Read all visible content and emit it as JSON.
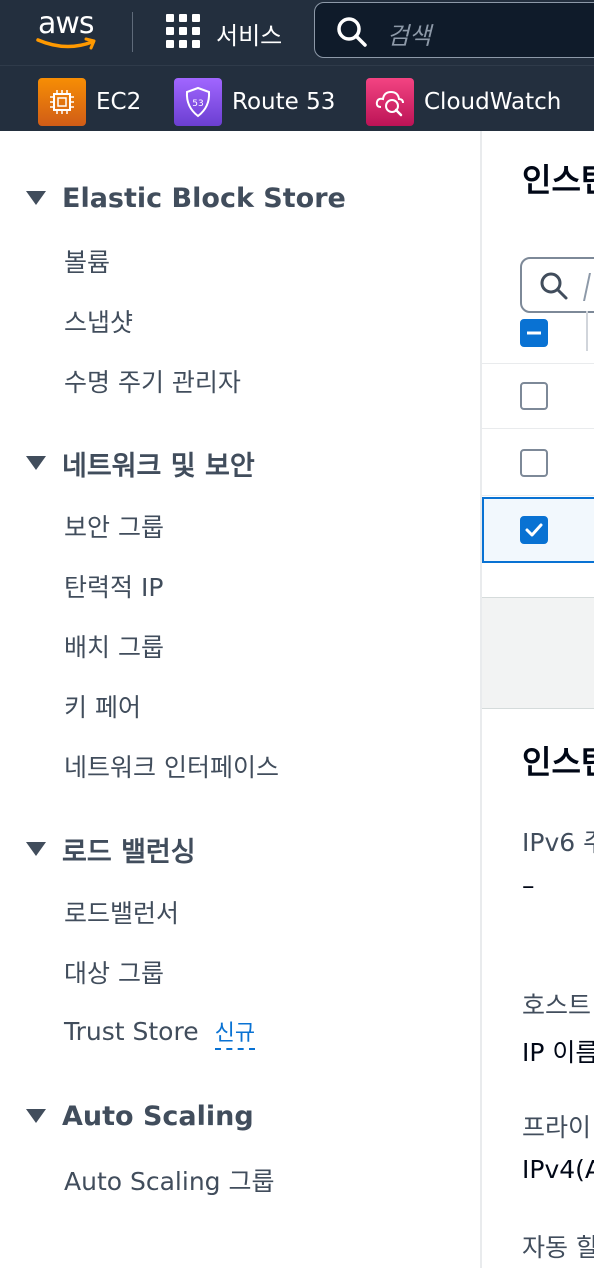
{
  "topbar": {
    "logo_text": "aws",
    "services_label": "서비스",
    "search_placeholder": "검색"
  },
  "favorites": [
    {
      "label": "EC2",
      "icon": "ec2-icon",
      "color": "#ed7100"
    },
    {
      "label": "Route 53",
      "icon": "route53-icon",
      "color": "#8c4fff"
    },
    {
      "label": "CloudWatch",
      "icon": "cloudwatch-icon",
      "color": "#e7157b"
    }
  ],
  "sidebar": {
    "sections": [
      {
        "title": "Elastic Block Store",
        "items": [
          "볼륨",
          "스냅샷",
          "수명 주기 관리자"
        ]
      },
      {
        "title": "네트워크 및 보안",
        "items": [
          "보안 그룹",
          "탄력적 IP",
          "배치 그룹",
          "키 페어",
          "네트워크 인터페이스"
        ]
      },
      {
        "title": "로드 밸런싱",
        "items": [
          "로드밸런서",
          "대상 그룹",
          "Trust Store"
        ],
        "badge": "신규"
      },
      {
        "title": "Auto Scaling",
        "items": [
          "Auto Scaling 그룹"
        ]
      }
    ]
  },
  "main": {
    "title": "인스턴",
    "search_placeholder": "I",
    "table_rows": [
      {
        "checked": false
      },
      {
        "checked": false
      },
      {
        "checked": true
      }
    ],
    "details": {
      "title": "인스턴",
      "ipv6_label": "IPv6 주",
      "ipv6_value": "–",
      "hostname_label": "호스트",
      "hostname_value": "IP 이름",
      "private_label": "프라이",
      "private_value": "IPv4(A",
      "auto_label": "자동 할"
    }
  },
  "colors": {
    "nav_bg": "#232f3e",
    "accent": "#0972d3",
    "text": "#414d5c"
  }
}
